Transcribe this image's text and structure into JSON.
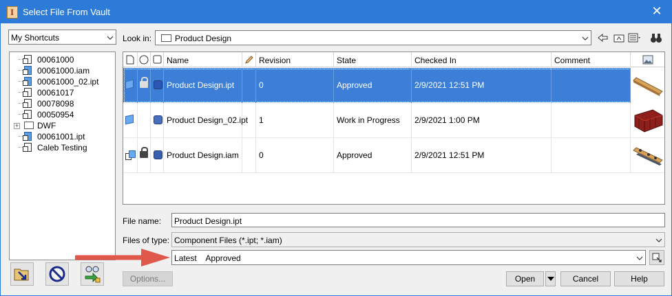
{
  "window": {
    "title": "Select File From Vault"
  },
  "shortcuts": {
    "value": "My Shortcuts"
  },
  "look_in": {
    "label": "Look in:",
    "value": "Product Design"
  },
  "tree": [
    {
      "label": "00061000",
      "type": "file"
    },
    {
      "label": "00061000.iam",
      "type": "asm"
    },
    {
      "label": "00061000_02.ipt",
      "type": "part"
    },
    {
      "label": "00061017",
      "type": "file"
    },
    {
      "label": "00078098",
      "type": "file"
    },
    {
      "label": "00050954",
      "type": "file"
    },
    {
      "label": "DWF",
      "type": "folder",
      "expander": "+"
    },
    {
      "label": "00061001.ipt",
      "type": "part"
    },
    {
      "label": "Caleb Testing",
      "type": "file"
    }
  ],
  "columns": {
    "name": "Name",
    "revision": "Revision",
    "state": "State",
    "checked_in": "Checked In",
    "comment": "Comment"
  },
  "rows": [
    {
      "name": "Product Design.ipt",
      "revision": "0",
      "state": "Approved",
      "checked_in": "2/9/2021 12:51 PM",
      "comment": "",
      "kind": "part",
      "locked": true,
      "selected": true
    },
    {
      "name": "Product Design_02.ipt",
      "revision": "1",
      "state": "Work in Progress",
      "checked_in": "2/9/2021 1:00 PM",
      "comment": "",
      "kind": "part",
      "locked": false,
      "selected": false
    },
    {
      "name": "Product Design.iam",
      "revision": "0",
      "state": "Approved",
      "checked_in": "2/9/2021 12:51 PM",
      "comment": "",
      "kind": "asm",
      "locked": true,
      "selected": false
    }
  ],
  "file_name": {
    "label": "File name:",
    "value": "Product Design.ipt"
  },
  "files_of_type": {
    "label": "Files of type:",
    "value": "Component Files (*.ipt; *.iam)"
  },
  "revision_filter": {
    "value": "Latest    Approved"
  },
  "buttons": {
    "options": "Options...",
    "open": "Open",
    "cancel": "Cancel",
    "help": "Help"
  },
  "colors": {
    "titlebar": "#2c7bd9",
    "selection": "#3d7fd6",
    "annotation_arrow": "#e0584a"
  }
}
